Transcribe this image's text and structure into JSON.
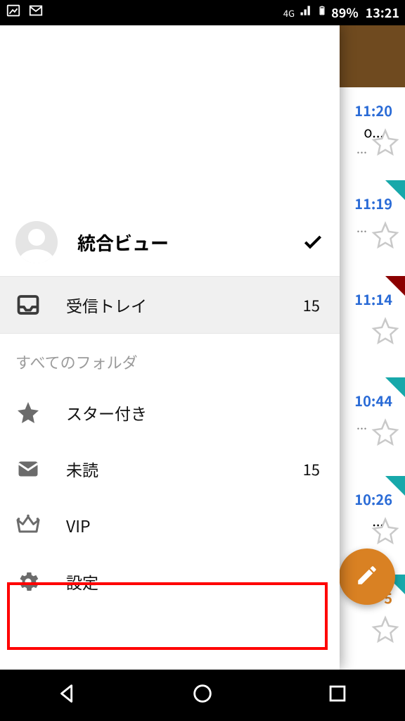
{
  "status": {
    "network_label": "4G",
    "battery_pct": "89%",
    "time": "13:21"
  },
  "background_mail": {
    "times": [
      "11:20",
      "11:19",
      "11:14",
      "10:44",
      "10:26"
    ],
    "last_partial_time": "5"
  },
  "drawer": {
    "account": {
      "name": "統合ビュー"
    },
    "inbox": {
      "label": "受信トレイ",
      "count": "15"
    },
    "section_title": "すべてのフォルダ",
    "starred": {
      "label": "スター付き"
    },
    "unread": {
      "label": "未読",
      "count": "15"
    },
    "vip": {
      "label": "VIP"
    },
    "settings": {
      "label": "設定"
    }
  }
}
